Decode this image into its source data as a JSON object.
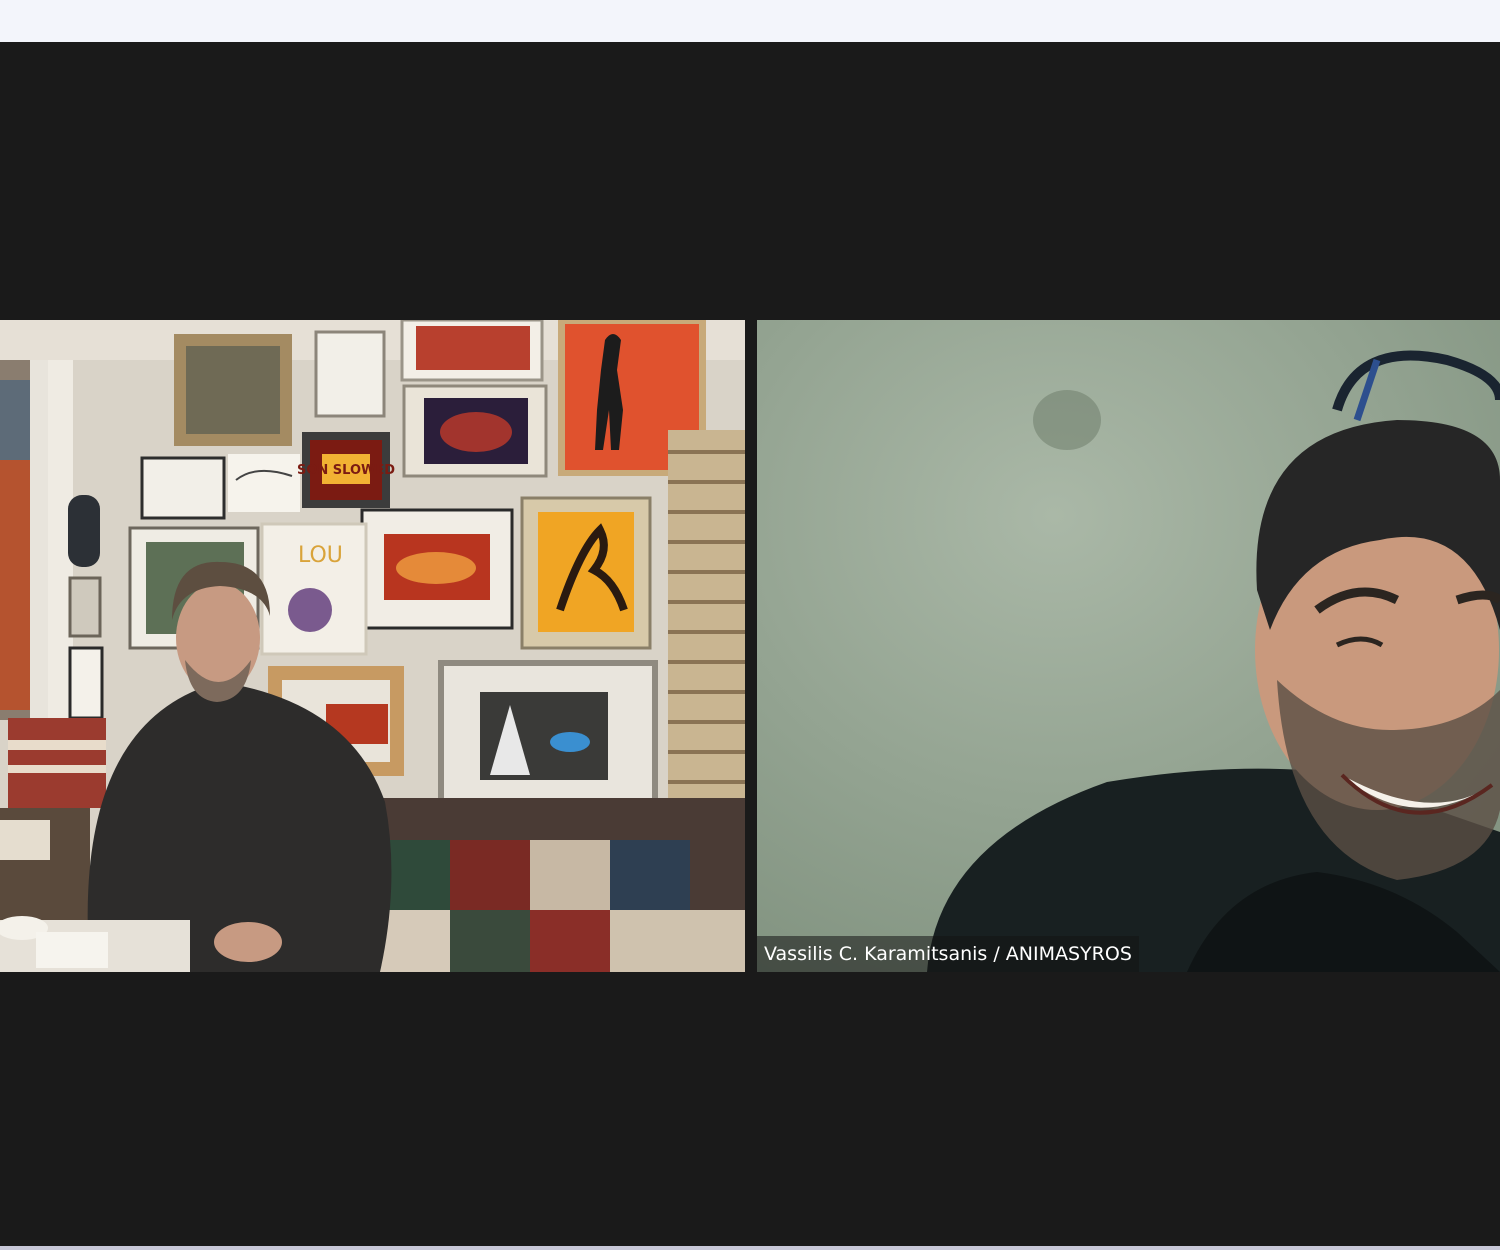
{
  "participants": [
    {
      "name": ""
    },
    {
      "name": "Vassilis C. Karamitsanis / ANIMASYROS"
    }
  ],
  "poster_lettering": {
    "sign": "SON SLOWED",
    "drawing": "LOU"
  },
  "colors": {
    "meeting_background": "#1a1a1a",
    "top_bar": "#f3f5fb",
    "name_label_bg": "rgba(20,20,20,0.55)",
    "name_label_text": "#ffffff"
  }
}
